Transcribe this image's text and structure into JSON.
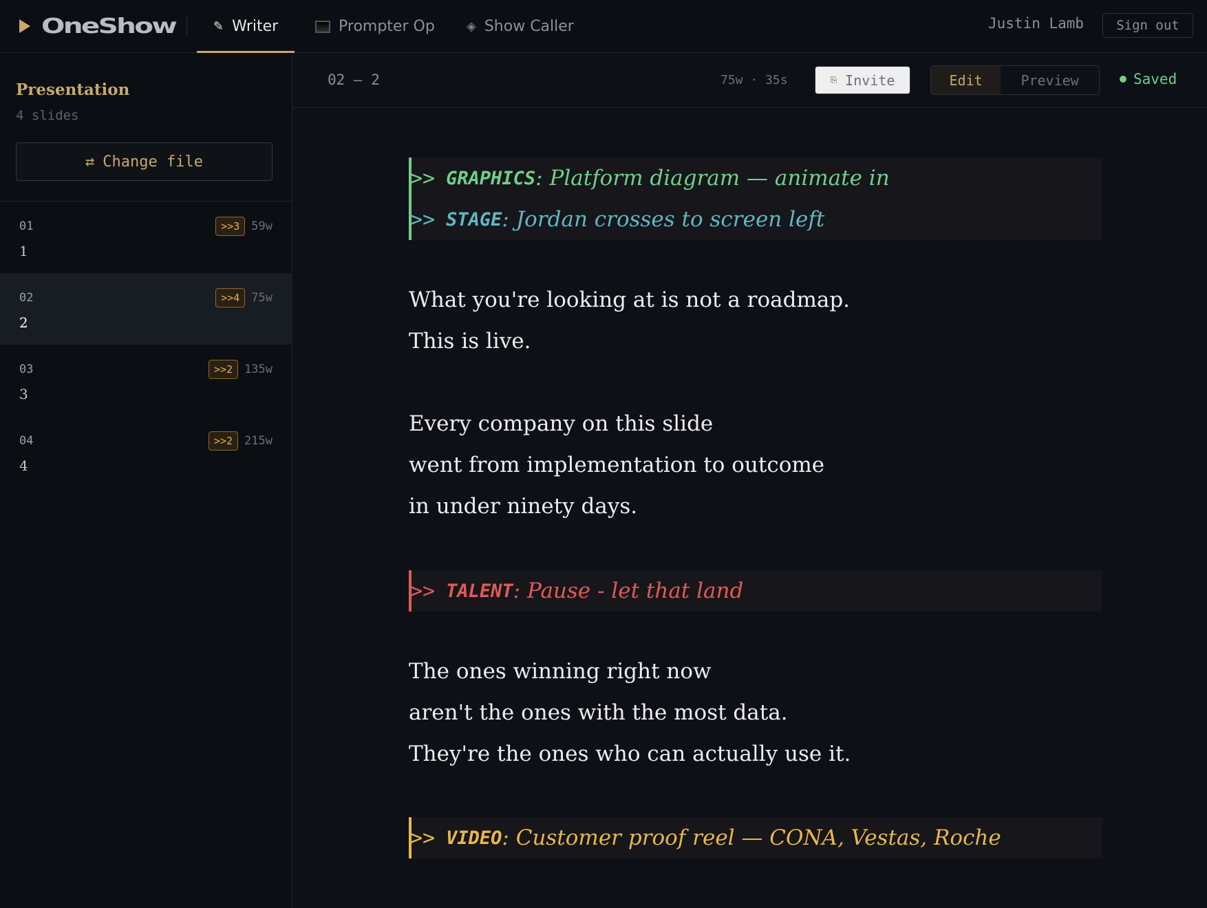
{
  "brand": {
    "name": "OneShow"
  },
  "nav": {
    "tabs": [
      {
        "label": "Writer",
        "icon": "pencil-icon"
      },
      {
        "label": "Prompter Op",
        "icon": "monitor-icon"
      },
      {
        "label": "Show Caller",
        "icon": "diamond-icon"
      }
    ],
    "active_tab": "Writer"
  },
  "user": {
    "name": "Justin Lamb",
    "signout_label": "Sign out"
  },
  "sidebar": {
    "title": "Presentation",
    "count": "4 slides",
    "change_file_label": "Change file",
    "slides": [
      {
        "num": "01",
        "name": "1",
        "cues": ">>3",
        "words": "59w"
      },
      {
        "num": "02",
        "name": "2",
        "cues": ">>4",
        "words": "75w"
      },
      {
        "num": "03",
        "name": "3",
        "cues": ">>2",
        "words": "135w"
      },
      {
        "num": "04",
        "name": "4",
        "cues": ">>2",
        "words": "215w"
      }
    ],
    "active_slide": "02"
  },
  "header": {
    "crumb": "02 — 2",
    "stats": "75w · 35s",
    "invite_label": "Invite",
    "edit_label": "Edit",
    "preview_label": "Preview",
    "saved_label": "Saved"
  },
  "editor": {
    "cue_prefix": ">>",
    "cue_blocks": [
      {
        "color": "#6fd08c",
        "lines": [
          {
            "key": "GRAPHICS",
            "text": "Platform diagram — animate in",
            "color": "#6fd08c"
          },
          {
            "key": "STAGE",
            "text": "Jordan crosses to screen left",
            "color": "#5fb8c2"
          }
        ]
      },
      {
        "color": "#e05a5a",
        "lines": [
          {
            "key": "TALENT",
            "text": "Pause - let that land",
            "color": "#e05a5a"
          }
        ]
      },
      {
        "color": "#e7b84a",
        "lines": [
          {
            "key": "VIDEO",
            "text": "Customer proof reel — CONA, Vestas, Roche",
            "color": "#e7b84a"
          }
        ]
      }
    ],
    "paragraphs": [
      [
        "What you're looking at is not a roadmap.",
        "This is live."
      ],
      [
        "Every company on this slide",
        "went from implementation to outcome",
        "in under ninety days."
      ],
      [
        "The ones winning right now",
        "aren't the ones with the most data.",
        "They're the ones who can actually use it."
      ]
    ]
  },
  "colors": {
    "accent": "#c9a86a",
    "graphics": "#6fd08c",
    "stage": "#5fb8c2",
    "talent": "#e05a5a",
    "video": "#e7b84a",
    "saved": "#6fd08c"
  }
}
